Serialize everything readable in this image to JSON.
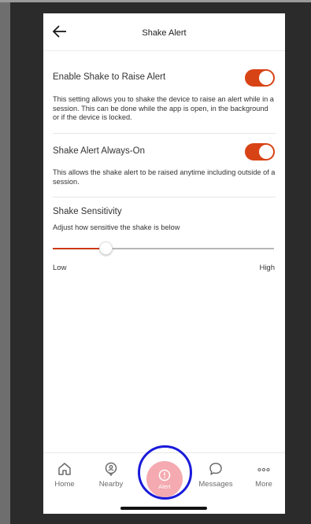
{
  "header": {
    "title": "Shake Alert",
    "back_icon": "arrow-left-icon"
  },
  "settings": [
    {
      "title": "Enable Shake to Raise Alert",
      "description": "This setting allows you to shake the device to raise an alert while in a session. This can be done while the app is open, in the background or if the device is locked.",
      "enabled": true
    },
    {
      "title": "Shake Alert Always-On",
      "description": "This allows the shake alert to be raised anytime including outside of a session.",
      "enabled": true
    }
  ],
  "sensitivity": {
    "title": "Shake Sensitivity",
    "description": "Adjust how sensitive the shake is below",
    "min_label": "Low",
    "max_label": "High",
    "value_fraction": 0.24
  },
  "tabbar": {
    "tabs": [
      {
        "label": "Home",
        "icon": "home-icon"
      },
      {
        "label": "Nearby",
        "icon": "location-pin-icon"
      },
      {
        "label": "Alert",
        "icon": "alert-icon"
      },
      {
        "label": "Messages",
        "icon": "chat-bubble-icon"
      },
      {
        "label": "More",
        "icon": "more-dots-icon"
      }
    ]
  },
  "colors": {
    "accent": "#d84315",
    "alert_button": "#f4aab0",
    "highlight_ring": "#1a1adb"
  }
}
